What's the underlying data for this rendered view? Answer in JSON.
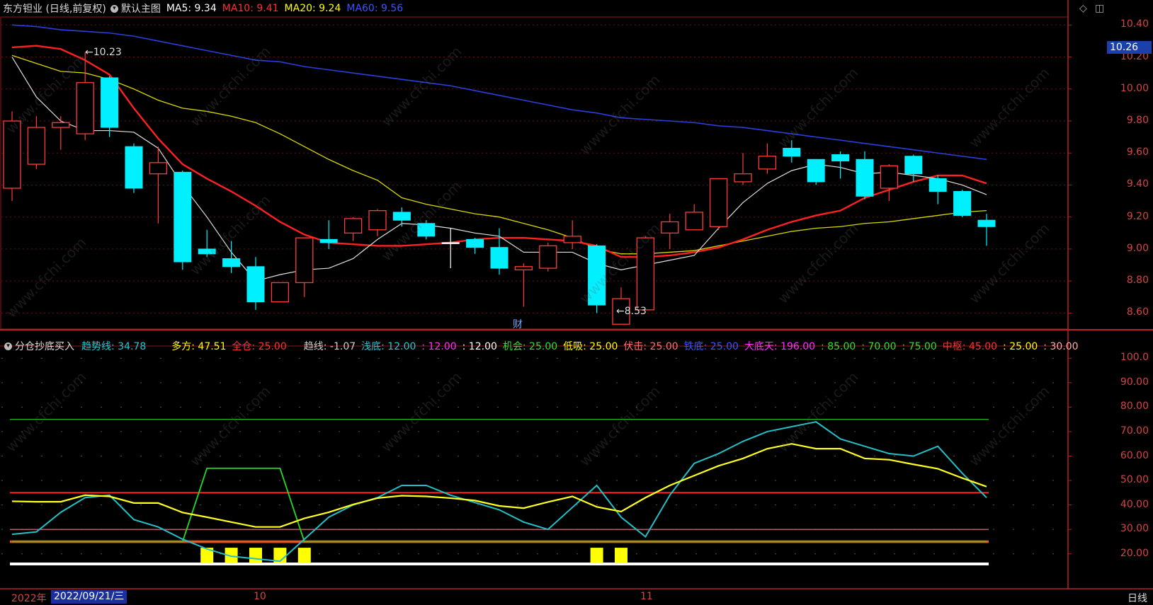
{
  "top_bar": {
    "stock": "东方钽业 (日线,前复权)",
    "main_chart": "默认主图",
    "ma": [
      {
        "label": "MA5: 9.34",
        "color": "#ffffff"
      },
      {
        "label": "MA10: 9.41",
        "color": "#ff3030"
      },
      {
        "label": "MA20: 9.24",
        "color": "#ffff00"
      },
      {
        "label": "MA60: 9.56",
        "color": "#3b55ff"
      }
    ]
  },
  "indicator_bar": {
    "name": "分仓抄底买入",
    "items": [
      {
        "label": "趋势线: 34.78",
        "color": "#22c8d4"
      },
      {
        "label": "多方: 47.51",
        "color": "#ffff00"
      },
      {
        "label": "全仓: 25.00",
        "color": "#ff3030"
      },
      {
        "label": "趋线: -1.07",
        "color": "#cccccc"
      },
      {
        "label": "浅底: 12.00",
        "color": "#22c8d4"
      },
      {
        "label": ": 12.00",
        "color": "#ff30ff"
      },
      {
        "label": ": 12.00",
        "color": "#ffffff"
      },
      {
        "label": "机会: 25.00",
        "color": "#30e030"
      },
      {
        "label": "低吸: 25.00",
        "color": "#ffff00"
      },
      {
        "label": "伏击: 25.00",
        "color": "#ff7070"
      },
      {
        "label": "铁底: 25.00",
        "color": "#3b55ff"
      },
      {
        "label": "大底天: 196.00",
        "color": "#ff30ff"
      },
      {
        "label": ": 85.00",
        "color": "#30e030"
      },
      {
        "label": ": 70.00",
        "color": "#30e030"
      },
      {
        "label": ": 75.00",
        "color": "#30e030"
      },
      {
        "label": "中枢: 45.00",
        "color": "#ff3030"
      },
      {
        "label": ": 25.00",
        "color": "#ffff00"
      },
      {
        "label": ": 30.00",
        "color": "#ffaaaa"
      }
    ]
  },
  "price_axis": [
    "10.40",
    "10.26",
    "10.20",
    "10.00",
    "9.80",
    "9.60",
    "9.40",
    "9.20",
    "9.00",
    "8.80",
    "8.60"
  ],
  "current_price": "10.26",
  "indicator_axis": [
    "100.0",
    "90.00",
    "80.00",
    "70.00",
    "60.00",
    "50.00",
    "40.00",
    "30.00",
    "20.00"
  ],
  "annotations": {
    "high": "←10.23",
    "low": "←8.53",
    "finance_marker": "财"
  },
  "bottom_bar": {
    "year": "2022年",
    "date": "2022/09/21/三",
    "month_10": "10",
    "month_11": "11",
    "period": "日线"
  },
  "watermark": "www.cfchi.com",
  "chart_data": {
    "type": "candlestick",
    "price_ylim": [
      8.5,
      10.45
    ],
    "candles": [
      {
        "o": 9.38,
        "c": 9.8,
        "h": 9.86,
        "l": 9.3
      },
      {
        "o": 9.53,
        "c": 9.76,
        "h": 9.83,
        "l": 9.5
      },
      {
        "o": 9.76,
        "c": 9.79,
        "h": 9.83,
        "l": 9.62
      },
      {
        "o": 9.72,
        "c": 10.04,
        "h": 10.23,
        "l": 9.68
      },
      {
        "o": 10.07,
        "c": 9.76,
        "h": 10.08,
        "l": 9.7
      },
      {
        "o": 9.64,
        "c": 9.38,
        "h": 9.66,
        "l": 9.35
      },
      {
        "o": 9.47,
        "c": 9.54,
        "h": 9.64,
        "l": 9.16
      },
      {
        "o": 9.48,
        "c": 8.92,
        "h": 9.49,
        "l": 8.87
      },
      {
        "o": 9.0,
        "c": 8.97,
        "h": 9.12,
        "l": 8.95
      },
      {
        "o": 8.94,
        "c": 8.89,
        "h": 9.05,
        "l": 8.85
      },
      {
        "o": 8.89,
        "c": 8.67,
        "h": 8.95,
        "l": 8.62
      },
      {
        "o": 8.67,
        "c": 8.79,
        "h": 8.79,
        "l": 8.67
      },
      {
        "o": 8.79,
        "c": 9.07,
        "h": 9.07,
        "l": 8.7
      },
      {
        "o": 9.06,
        "c": 9.04,
        "h": 9.18,
        "l": 9.0
      },
      {
        "o": 9.1,
        "c": 9.19,
        "h": 9.2,
        "l": 9.05
      },
      {
        "o": 9.12,
        "c": 9.24,
        "h": 9.25,
        "l": 9.08
      },
      {
        "o": 9.23,
        "c": 9.18,
        "h": 9.26,
        "l": 9.14
      },
      {
        "o": 9.16,
        "c": 9.08,
        "h": 9.18,
        "l": 9.06
      },
      {
        "o": 9.04,
        "c": 9.04,
        "h": 9.13,
        "l": 8.88
      },
      {
        "o": 9.06,
        "c": 9.01,
        "h": 9.07,
        "l": 8.97
      },
      {
        "o": 9.01,
        "c": 8.88,
        "h": 9.13,
        "l": 8.84
      },
      {
        "o": 8.87,
        "c": 8.89,
        "h": 8.91,
        "l": 8.64
      },
      {
        "o": 8.88,
        "c": 9.02,
        "h": 9.04,
        "l": 8.86
      },
      {
        "o": 9.04,
        "c": 9.08,
        "h": 9.18,
        "l": 9.0
      },
      {
        "o": 9.02,
        "c": 8.65,
        "h": 9.03,
        "l": 8.6
      },
      {
        "o": 8.53,
        "c": 8.69,
        "h": 8.76,
        "l": 8.53
      },
      {
        "o": 8.62,
        "c": 9.07,
        "h": 9.08,
        "l": 8.62
      },
      {
        "o": 9.1,
        "c": 9.17,
        "h": 9.22,
        "l": 9.0
      },
      {
        "o": 9.12,
        "c": 9.23,
        "h": 9.28,
        "l": 9.12
      },
      {
        "o": 9.14,
        "c": 9.44,
        "h": 9.44,
        "l": 9.12
      },
      {
        "o": 9.42,
        "c": 9.47,
        "h": 9.6,
        "l": 9.4
      },
      {
        "o": 9.5,
        "c": 9.58,
        "h": 9.66,
        "l": 9.47
      },
      {
        "o": 9.63,
        "c": 9.58,
        "h": 9.68,
        "l": 9.54
      },
      {
        "o": 9.56,
        "c": 9.42,
        "h": 9.56,
        "l": 9.4
      },
      {
        "o": 9.59,
        "c": 9.55,
        "h": 9.61,
        "l": 9.44
      },
      {
        "o": 9.56,
        "c": 9.33,
        "h": 9.61,
        "l": 9.31
      },
      {
        "o": 9.38,
        "c": 9.52,
        "h": 9.53,
        "l": 9.3
      },
      {
        "o": 9.58,
        "c": 9.47,
        "h": 9.59,
        "l": 9.42
      },
      {
        "o": 9.44,
        "c": 9.36,
        "h": 9.46,
        "l": 9.28
      },
      {
        "o": 9.36,
        "c": 9.21,
        "h": 9.37,
        "l": 9.2
      },
      {
        "o": 9.18,
        "c": 9.14,
        "h": 9.22,
        "l": 9.02
      }
    ],
    "ma5": [
      10.2,
      9.95,
      9.8,
      9.74,
      9.74,
      9.73,
      9.63,
      9.4,
      9.2,
      8.98,
      8.8,
      8.84,
      8.87,
      8.88,
      8.94,
      9.06,
      9.16,
      9.15,
      9.13,
      9.1,
      9.08,
      8.98,
      8.98,
      8.98,
      8.91,
      8.87,
      8.9,
      8.93,
      8.96,
      9.13,
      9.29,
      9.41,
      9.49,
      9.53,
      9.51,
      9.47,
      9.48,
      9.46,
      9.44,
      9.4,
      9.34
    ],
    "ma10": [
      10.26,
      10.27,
      10.25,
      10.18,
      10.09,
      9.88,
      9.69,
      9.53,
      9.44,
      9.36,
      9.27,
      9.17,
      9.09,
      9.04,
      9.03,
      9.02,
      9.02,
      9.03,
      9.04,
      9.06,
      9.07,
      9.07,
      9.06,
      9.05,
      9.02,
      8.95,
      8.95,
      8.96,
      8.98,
      9.01,
      9.06,
      9.12,
      9.17,
      9.21,
      9.24,
      9.32,
      9.37,
      9.42,
      9.46,
      9.46,
      9.41
    ],
    "ma20": [
      10.21,
      10.16,
      10.11,
      10.1,
      10.06,
      10.0,
      9.93,
      9.88,
      9.86,
      9.83,
      9.79,
      9.72,
      9.64,
      9.56,
      9.49,
      9.43,
      9.32,
      9.28,
      9.25,
      9.22,
      9.2,
      9.16,
      9.12,
      9.07,
      9.0,
      8.97,
      8.97,
      8.98,
      8.99,
      9.02,
      9.05,
      9.08,
      9.11,
      9.13,
      9.14,
      9.16,
      9.17,
      9.19,
      9.21,
      9.23,
      9.24
    ],
    "ma60": [
      10.4,
      10.39,
      10.37,
      10.36,
      10.35,
      10.33,
      10.3,
      10.27,
      10.24,
      10.21,
      10.18,
      10.17,
      10.14,
      10.12,
      10.1,
      10.08,
      10.06,
      10.04,
      10.02,
      9.99,
      9.96,
      9.93,
      9.9,
      9.87,
      9.85,
      9.82,
      9.81,
      9.8,
      9.79,
      9.77,
      9.76,
      9.74,
      9.72,
      9.7,
      9.68,
      9.66,
      9.64,
      9.62,
      9.6,
      9.58,
      9.56
    ],
    "indicator_ylim": [
      15,
      105
    ],
    "trend_line": [
      28,
      29,
      37,
      43,
      44,
      34,
      31,
      26,
      22,
      19,
      18,
      17,
      26,
      35,
      40,
      43,
      48,
      48,
      44,
      41,
      38,
      33,
      30,
      39,
      48,
      35,
      27,
      44,
      57,
      61,
      66,
      70,
      72,
      74,
      67,
      64,
      61,
      60,
      64,
      53,
      43,
      35
    ],
    "duofang": [
      41.5,
      41.3,
      41.3,
      44,
      43.5,
      40.8,
      40.8,
      36.9,
      35,
      33,
      31,
      31,
      34.5,
      37,
      40.2,
      42.8,
      43.8,
      43.5,
      42.8,
      41.8,
      39.6,
      38.7,
      41.2,
      43.5,
      39.2,
      37.3,
      43,
      48,
      52,
      56,
      59,
      63,
      65,
      63,
      63,
      59,
      58.5,
      56.6,
      54.8,
      51,
      47.5
    ],
    "chance_line": [
      25,
      25,
      25,
      25,
      25,
      25,
      25,
      25,
      55,
      55,
      55,
      55,
      25,
      25,
      25,
      25,
      25,
      25,
      25,
      25,
      25,
      25,
      25,
      25,
      25,
      25,
      25,
      25,
      25,
      25,
      25,
      25,
      25,
      25,
      25,
      25,
      25,
      25,
      25,
      25,
      25
    ],
    "zhongshu": 45,
    "level_30": 30,
    "level_25": 25,
    "level_75": 75,
    "buy_bars": [
      8,
      9,
      10,
      11,
      12,
      24,
      25
    ]
  }
}
